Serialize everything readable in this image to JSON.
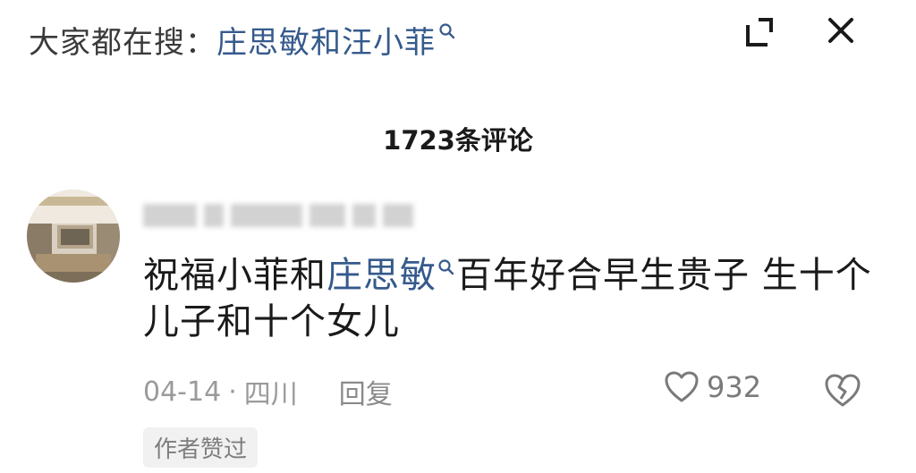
{
  "header": {
    "prefix": "大家都在搜：",
    "query": "庄思敏和汪小菲",
    "search_icon": "search-icon",
    "expand_icon": "expand-icon",
    "close_icon": "close-icon"
  },
  "comments_header": {
    "count_label": "1723条评论"
  },
  "comment": {
    "avatar_icon": "avatar",
    "text_before": "祝福小菲和",
    "link_text": "庄思敏",
    "link_icon": "search-icon",
    "text_after": "百年好合早生贵子 生十个儿子和十个女儿",
    "date": "04-14",
    "separator": "·",
    "location": "四川",
    "reply_label": "回复",
    "like_icon": "heart-icon",
    "like_count": "932",
    "dislike_icon": "broken-heart-icon",
    "author_badge": "作者赞过"
  },
  "colors": {
    "link": "#355a8c",
    "text": "#1a1a1a",
    "muted": "#9a9a9a"
  }
}
